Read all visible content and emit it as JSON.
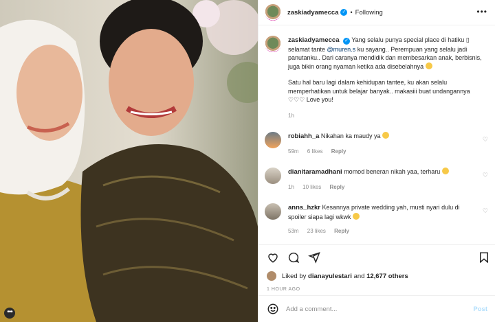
{
  "post": {
    "username": "zaskiadyamecca",
    "following_label": "Following",
    "caption": {
      "line1": "Yang selalu punya special place di hatiku ▯ selamat tante ",
      "mention": "@muren.s",
      "line1_rest": " ku sayang.. Perempuan yang selalu jadi panutanku.. Dari caranya mendidik dan membesarkan anak, berbisnis, juga bikin orang nyaman ketika ada disebelahnya",
      "paragraph2": "Satu hal baru lagi dalam kehidupan tantee, ku akan selalu memperhatikan untuk belajar banyak.. makasiii buat undangannya ♡♡♡ Love you!",
      "time": "1h"
    },
    "comments": [
      {
        "username": "robiahh_a",
        "text": "Nikahan ka maudy ya",
        "time": "59m",
        "likes": "6 likes",
        "reply": "Reply"
      },
      {
        "username": "dianitaramadhani",
        "text": "momod beneran nikah yaa, terharu",
        "time": "1h",
        "likes": "10 likes",
        "reply": "Reply"
      },
      {
        "username": "anns_hzkr",
        "text": "Kesannya private wedding yah, musti nyari dulu di spoiler siapa lagi wkwk",
        "time": "53m",
        "likes": "23 likes",
        "reply": "Reply"
      }
    ],
    "liked_by": {
      "prefix": "Liked by",
      "user": "dianayulestari",
      "and": "and",
      "count": "12,677 others"
    },
    "timestamp": "1 HOUR AGO",
    "add_comment_placeholder": "Add a comment...",
    "post_button": "Post"
  },
  "icons": {
    "photo_more": "more-dots-icon",
    "header_more": "ellipsis-icon",
    "like": "heart-icon",
    "comment": "comment-icon",
    "share": "share-icon",
    "save": "bookmark-icon",
    "emoji": "smile-icon"
  },
  "colors": {
    "verified": "#0095f6",
    "link": "#00376b",
    "muted": "#8e8e8e",
    "post_button": "#b2dffc"
  }
}
